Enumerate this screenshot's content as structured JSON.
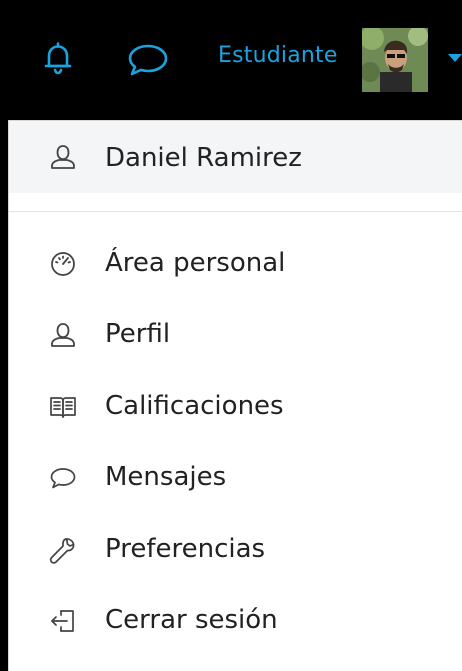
{
  "navbar": {
    "background": "#000000",
    "accent": "#19a3e0",
    "role_label": "Estudiante",
    "icons": [
      "bell-icon",
      "chat-bubble-icon",
      "caret-down-icon"
    ]
  },
  "menu": {
    "user": {
      "label": "Daniel Ramirez",
      "icon": "user-icon"
    },
    "items": [
      {
        "label": "Área personal",
        "icon": "dashboard-icon"
      },
      {
        "label": "Perfil",
        "icon": "user-icon"
      },
      {
        "label": "Calificaciones",
        "icon": "grades-icon"
      },
      {
        "label": "Mensajes",
        "icon": "chat-bubble-icon"
      },
      {
        "label": "Preferencias",
        "icon": "wrench-icon"
      },
      {
        "label": "Cerrar sesión",
        "icon": "logout-icon"
      }
    ]
  }
}
